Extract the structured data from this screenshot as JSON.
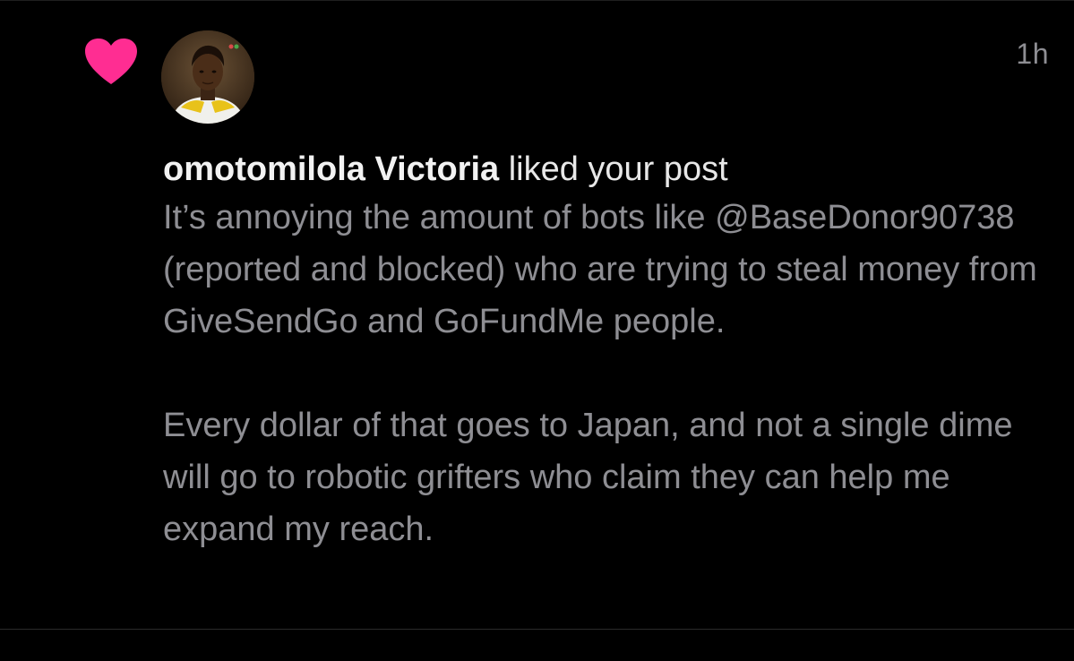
{
  "notification": {
    "timestamp": "1h",
    "username": "omotomilola Victoria",
    "action": "liked your post",
    "post_paragraphs": [
      "It’s annoying the amount of bots like @BaseDonor90738 (reported and blocked) who are trying to steal money from GiveSendGo and GoFundMe people.",
      "Every dollar of that goes to Japan, and not a single dime will go to robotic grifters who claim they can help me expand my reach."
    ],
    "icon": "heart-icon",
    "colors": {
      "heart": "#ff2d92",
      "background": "#000000",
      "username": "#f2f2f2",
      "post_text": "#8e8e93",
      "timestamp": "#8e8e93"
    }
  }
}
